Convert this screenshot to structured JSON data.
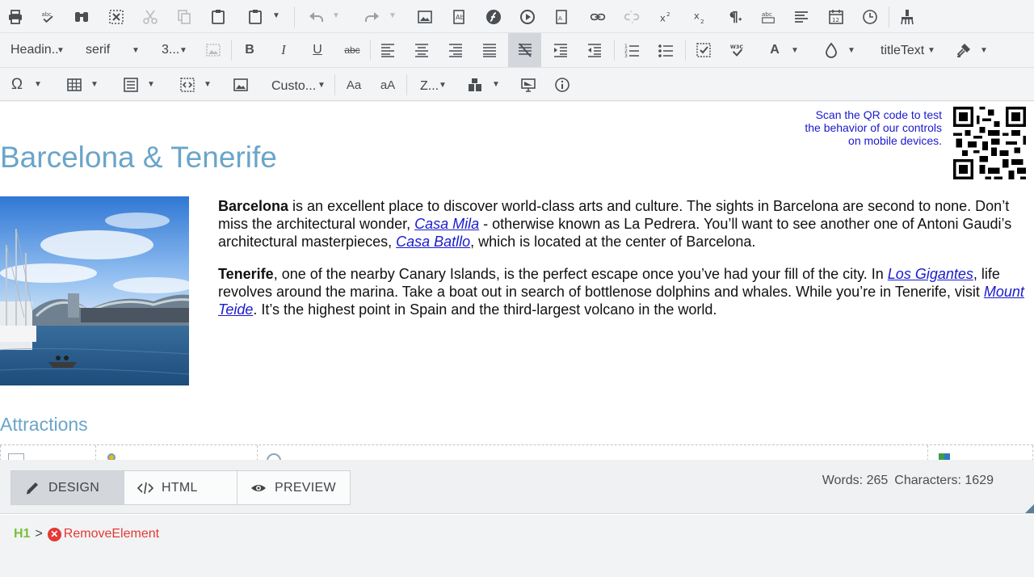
{
  "toolbar": {
    "row2": {
      "paragraph_format": "Headin..",
      "font_name": "serif",
      "font_size": "3...",
      "css_class": "titleText"
    },
    "row3": {
      "custom_links": "Custo...",
      "zoom": "Z..."
    }
  },
  "content": {
    "qr_note": [
      "Scan the QR code to test",
      "the behavior of our controls",
      "on mobile devices."
    ],
    "title": "Barcelona & Tenerife",
    "para1": {
      "bold": "Barcelona",
      "t1": " is an excellent place to discover world-class arts and culture. The sights in Barcelona are second to none. Don’t miss the architectural wonder, ",
      "link1": "Casa Mila",
      "t2": " - otherwise known as La Pedrera. You’ll want to see another one of Antoni Gaudi’s architectural masterpieces, ",
      "link2": "Casa Batllo",
      "t3": ", which is located at the center of Barcelona."
    },
    "para2": {
      "bold": "Tenerife",
      "t1": ", one of the nearby Canary Islands, is the perfect escape once you’ve had your fill of the city. In ",
      "link1": "Los Gigantes",
      "t2": ", life revolves around the marina. Take a boat out in search of bottlenose dolphins and whales. While you’re in Tenerife, visit ",
      "link2": "Mount Teide",
      "t3": ". It’s the highest point in Spain and the third-largest volcano in the world."
    },
    "attractions_heading": "Attractions"
  },
  "modes": {
    "design": "DESIGN",
    "html": "HTML",
    "preview": "PREVIEW"
  },
  "stats": {
    "words": "Words: 265",
    "characters": "Characters: 1629"
  },
  "status_path": {
    "element": "H1",
    "separator": ">",
    "action": "RemoveElement"
  },
  "colors": {
    "heading": "#6aa5c9",
    "link": "#1a1acd",
    "remove": "#e53935",
    "path_element": "#7cbf3b"
  }
}
